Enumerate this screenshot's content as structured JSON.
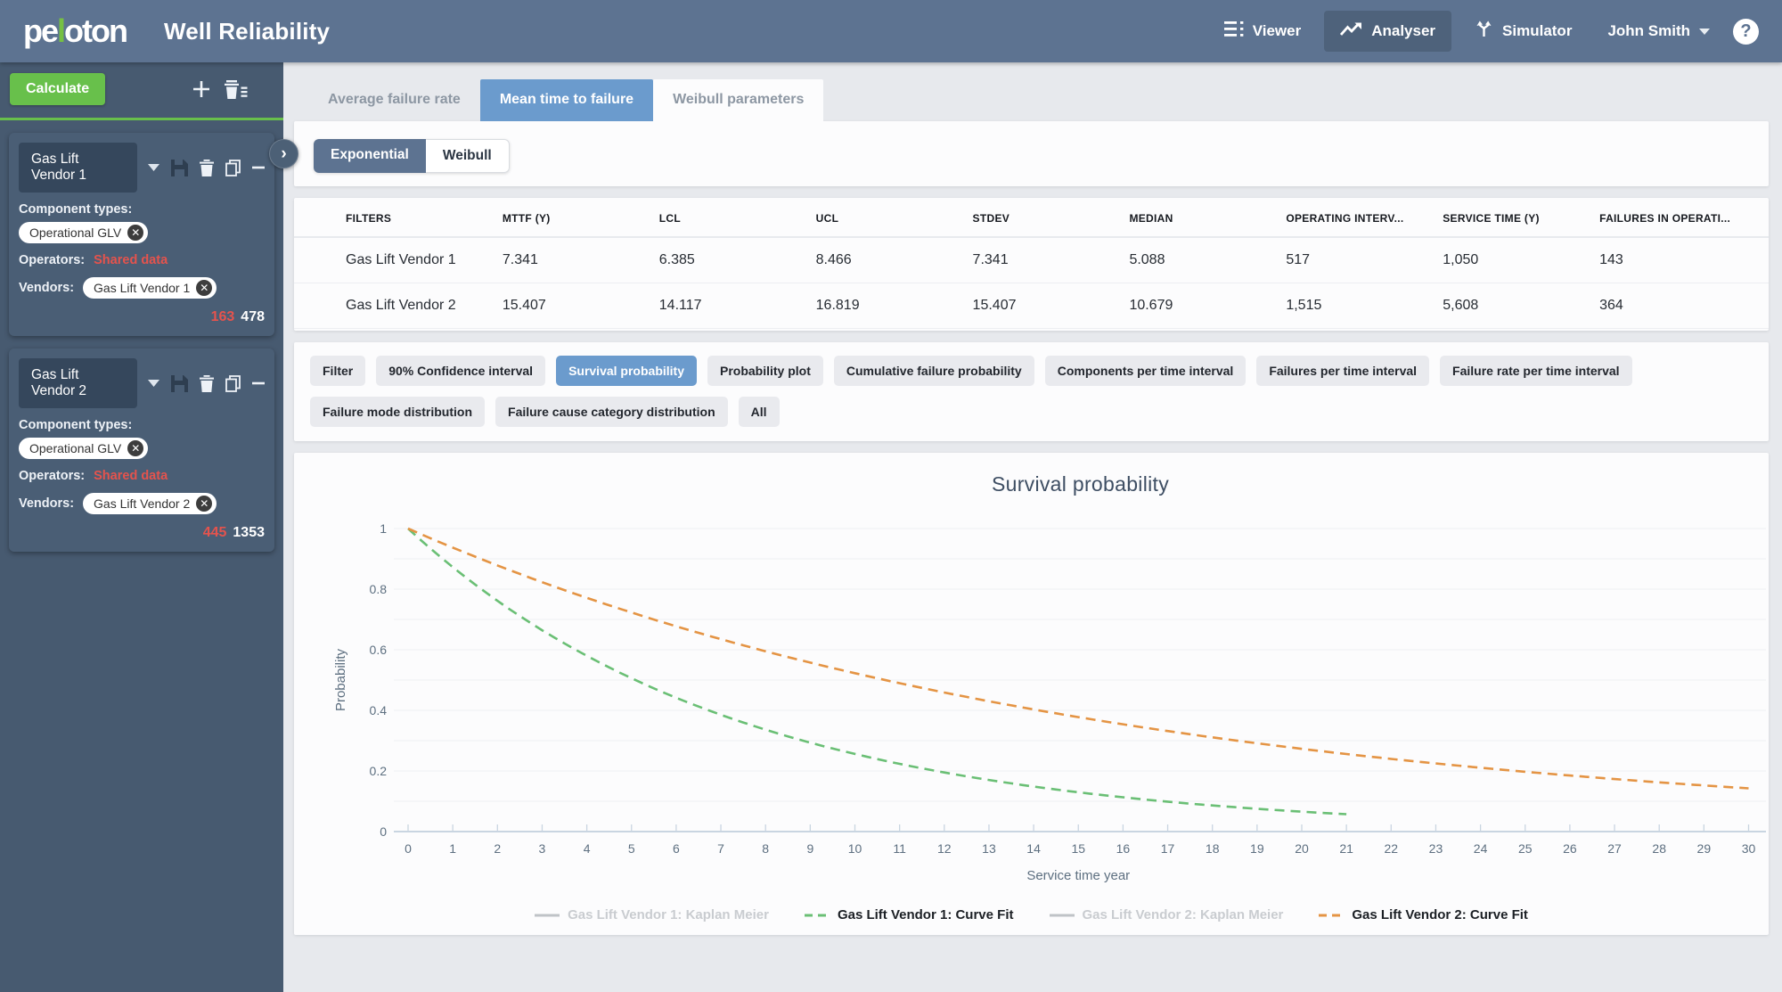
{
  "header": {
    "logo": {
      "part1": "pe",
      "accent": "l",
      "part2": "oton"
    },
    "app_title": "Well Reliability",
    "nav": [
      {
        "label": "Viewer"
      },
      {
        "label": "Analyser",
        "active": true
      },
      {
        "label": "Simulator"
      }
    ],
    "user_name": "John Smith"
  },
  "sidebar": {
    "calculate_label": "Calculate",
    "labels": {
      "component_types": "Component types:",
      "operators": "Operators:",
      "vendors": "Vendors:"
    },
    "panels": [
      {
        "title": "Gas Lift Vendor 1",
        "component_types": [
          "Operational GLV"
        ],
        "operators_value": "Shared data",
        "vendors": [
          "Gas Lift Vendor 1"
        ],
        "count_red": "163",
        "count_white": "478"
      },
      {
        "title": "Gas Lift Vendor 2",
        "component_types": [
          "Operational GLV"
        ],
        "operators_value": "Shared data",
        "vendors": [
          "Gas Lift Vendor 2"
        ],
        "count_red": "445",
        "count_white": "1353"
      }
    ]
  },
  "tabs": [
    {
      "label": "Average failure rate"
    },
    {
      "label": "Mean time to failure",
      "active": true
    },
    {
      "label": "Weibull parameters"
    }
  ],
  "distribution_toggle": [
    {
      "label": "Exponential",
      "selected": true
    },
    {
      "label": "Weibull",
      "selected": false
    }
  ],
  "table": {
    "columns": [
      "FILTERS",
      "MTTF (Y)",
      "LCL",
      "UCL",
      "STDEV",
      "MEDIAN",
      "OPERATING INTERV...",
      "SERVICE TIME (Y)",
      "FAILURES IN OPERATI..."
    ],
    "rows": [
      [
        "Gas Lift Vendor 1",
        "7.341",
        "6.385",
        "8.466",
        "7.341",
        "5.088",
        "517",
        "1,050",
        "143"
      ],
      [
        "Gas Lift Vendor 2",
        "15.407",
        "14.117",
        "16.819",
        "15.407",
        "10.679",
        "1,515",
        "5,608",
        "364"
      ]
    ]
  },
  "chart_buttons": [
    {
      "label": "Filter",
      "active": false
    },
    {
      "label": "90% Confidence interval",
      "active": false
    },
    {
      "label": "Survival probability",
      "active": true
    },
    {
      "label": "Probability plot",
      "active": false
    },
    {
      "label": "Cumulative failure probability",
      "active": false
    },
    {
      "label": "Components per time interval",
      "active": false
    },
    {
      "label": "Failures per time interval",
      "active": false
    },
    {
      "label": "Failure rate per time interval",
      "active": false
    },
    {
      "label": "Failure mode distribution",
      "active": false
    },
    {
      "label": "Failure cause category distribution",
      "active": false
    },
    {
      "label": "All",
      "active": false
    }
  ],
  "chart_data": {
    "type": "line",
    "title": "Survival probability",
    "xlabel": "Service time year",
    "ylabel": "Probability",
    "xlim": [
      0,
      30
    ],
    "ylim": [
      0,
      1
    ],
    "x_ticks": [
      0,
      1,
      2,
      3,
      4,
      5,
      6,
      7,
      8,
      9,
      10,
      11,
      12,
      13,
      14,
      15,
      16,
      17,
      18,
      19,
      20,
      21,
      22,
      23,
      24,
      25,
      26,
      27,
      28,
      29,
      30
    ],
    "y_ticks": [
      0,
      0.2,
      0.4,
      0.6,
      0.8,
      1
    ],
    "y_minor_step": 0.1,
    "grid": "horizontal",
    "legend_position": "bottom",
    "series": [
      {
        "name": "Gas Lift Vendor 1: Kaplan Meier",
        "style": "solid",
        "color": "#bfc3c7",
        "visible": false
      },
      {
        "name": "Gas Lift Vendor 1: Curve Fit",
        "style": "dashed",
        "color": "#6abf75",
        "visible": true,
        "model": "exponential",
        "mttf_years": 7.341,
        "x": [
          0,
          1,
          2,
          3,
          4,
          5,
          6,
          7,
          8,
          9,
          10,
          11,
          12,
          13,
          14,
          15,
          16,
          17,
          18,
          19,
          20,
          21
        ],
        "y": [
          1,
          0.873,
          0.762,
          0.665,
          0.58,
          0.506,
          0.442,
          0.385,
          0.337,
          0.294,
          0.256,
          0.224,
          0.195,
          0.171,
          0.149,
          0.13,
          0.113,
          0.099,
          0.086,
          0.075,
          0.066,
          0.057
        ]
      },
      {
        "name": "Gas Lift Vendor 2: Kaplan Meier",
        "style": "solid",
        "color": "#bfc3c7",
        "visible": false
      },
      {
        "name": "Gas Lift Vendor 2: Curve Fit",
        "style": "dashed",
        "color": "#e49444",
        "visible": true,
        "model": "exponential",
        "mttf_years": 15.407,
        "x": [
          0,
          1,
          2,
          3,
          4,
          5,
          6,
          7,
          8,
          9,
          10,
          11,
          12,
          13,
          14,
          15,
          16,
          17,
          18,
          19,
          20,
          21,
          22,
          23,
          24,
          25,
          26,
          27,
          28,
          29,
          30
        ],
        "y": [
          1,
          0.937,
          0.878,
          0.823,
          0.771,
          0.723,
          0.677,
          0.635,
          0.595,
          0.557,
          0.522,
          0.489,
          0.459,
          0.43,
          0.403,
          0.378,
          0.354,
          0.332,
          0.311,
          0.291,
          0.273,
          0.256,
          0.24,
          0.225,
          0.211,
          0.197,
          0.185,
          0.173,
          0.162,
          0.152,
          0.143
        ]
      }
    ],
    "colors": {
      "accent_blue": "#6b9bcd",
      "green": "#68c04b",
      "red": "#e5534d",
      "header": "#5d7391",
      "sidebar": "#475a70"
    }
  }
}
